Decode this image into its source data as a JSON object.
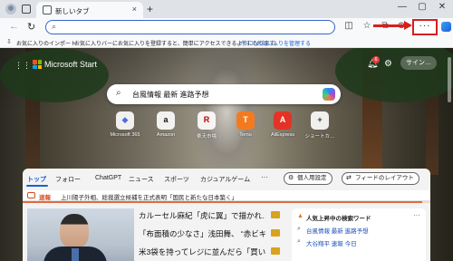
{
  "browser": {
    "tab_title": "新しいタブ",
    "new_tab_symbol": "+",
    "tab_close_symbol": "×",
    "window": {
      "min": "—",
      "max": "▢",
      "close": "✕"
    }
  },
  "toolbar": {
    "back_symbol": "←",
    "refresh_symbol": "↻",
    "address_value": "",
    "more_label": "···",
    "icons": [
      "split-screen-icon",
      "favorites-star-icon",
      "collections-icon",
      "extensions-icon",
      "more-options-icon",
      "copilot-icon"
    ]
  },
  "favorites_bar": {
    "import_label": "お気に入りのインポート",
    "message": "お気に入りバーにお気に入りを登録すると、簡単にアクセスできるようになります。",
    "link_text": "今すぐお気に入りを管理する"
  },
  "ntp": {
    "brand": "Microsoft Start",
    "notification_count": "6",
    "signin_label": "サイン…",
    "search_text": "台風情報 最新 進路予想",
    "quick_links": [
      {
        "label": "Microsoft 365",
        "glyph": "◆",
        "color": "#4f6bd8"
      },
      {
        "label": "Amazon",
        "glyph": "a",
        "color": "#111111"
      },
      {
        "label": "楽天市場",
        "glyph": "R",
        "color": "#bf0000"
      },
      {
        "label": "Temu",
        "glyph": "T",
        "color": "#f47a20"
      },
      {
        "label": "AliExpress",
        "glyph": "A",
        "color": "#e43225"
      },
      {
        "label": "ショートカ…",
        "glyph": "+",
        "color": "#333333"
      }
    ]
  },
  "feed": {
    "nav": [
      "トップ",
      "フォロー",
      "ChatGPT",
      "ニュース",
      "スポーツ",
      "カジュアルゲーム"
    ],
    "more_symbol": "···",
    "personalize_label": "個人用設定",
    "layout_label": "フィードのレイアウト",
    "breaking_label": "速報",
    "breaking_text": "上川陽子外相、総裁選立候補を正式表明「国民と新たな日本築く」",
    "breaking_progress": 0.98,
    "headlines": [
      "カルーセル麻紀「虎に翼」で描かれ…",
      "「布面積の少なさ」浅田舞、 “赤ビキ…",
      "米3袋を持ってレジに並んだら「買い…"
    ],
    "trending_title": "人気上昇中の検索ワード",
    "trending_more": "···",
    "trending": [
      "台風情報 最新 進路予想",
      "大谷翔平 速報 今日"
    ]
  },
  "colors": {
    "accent": "#1a5fd6",
    "highlight_red": "#d81e1e",
    "breaking_orange": "#d84a1c"
  }
}
